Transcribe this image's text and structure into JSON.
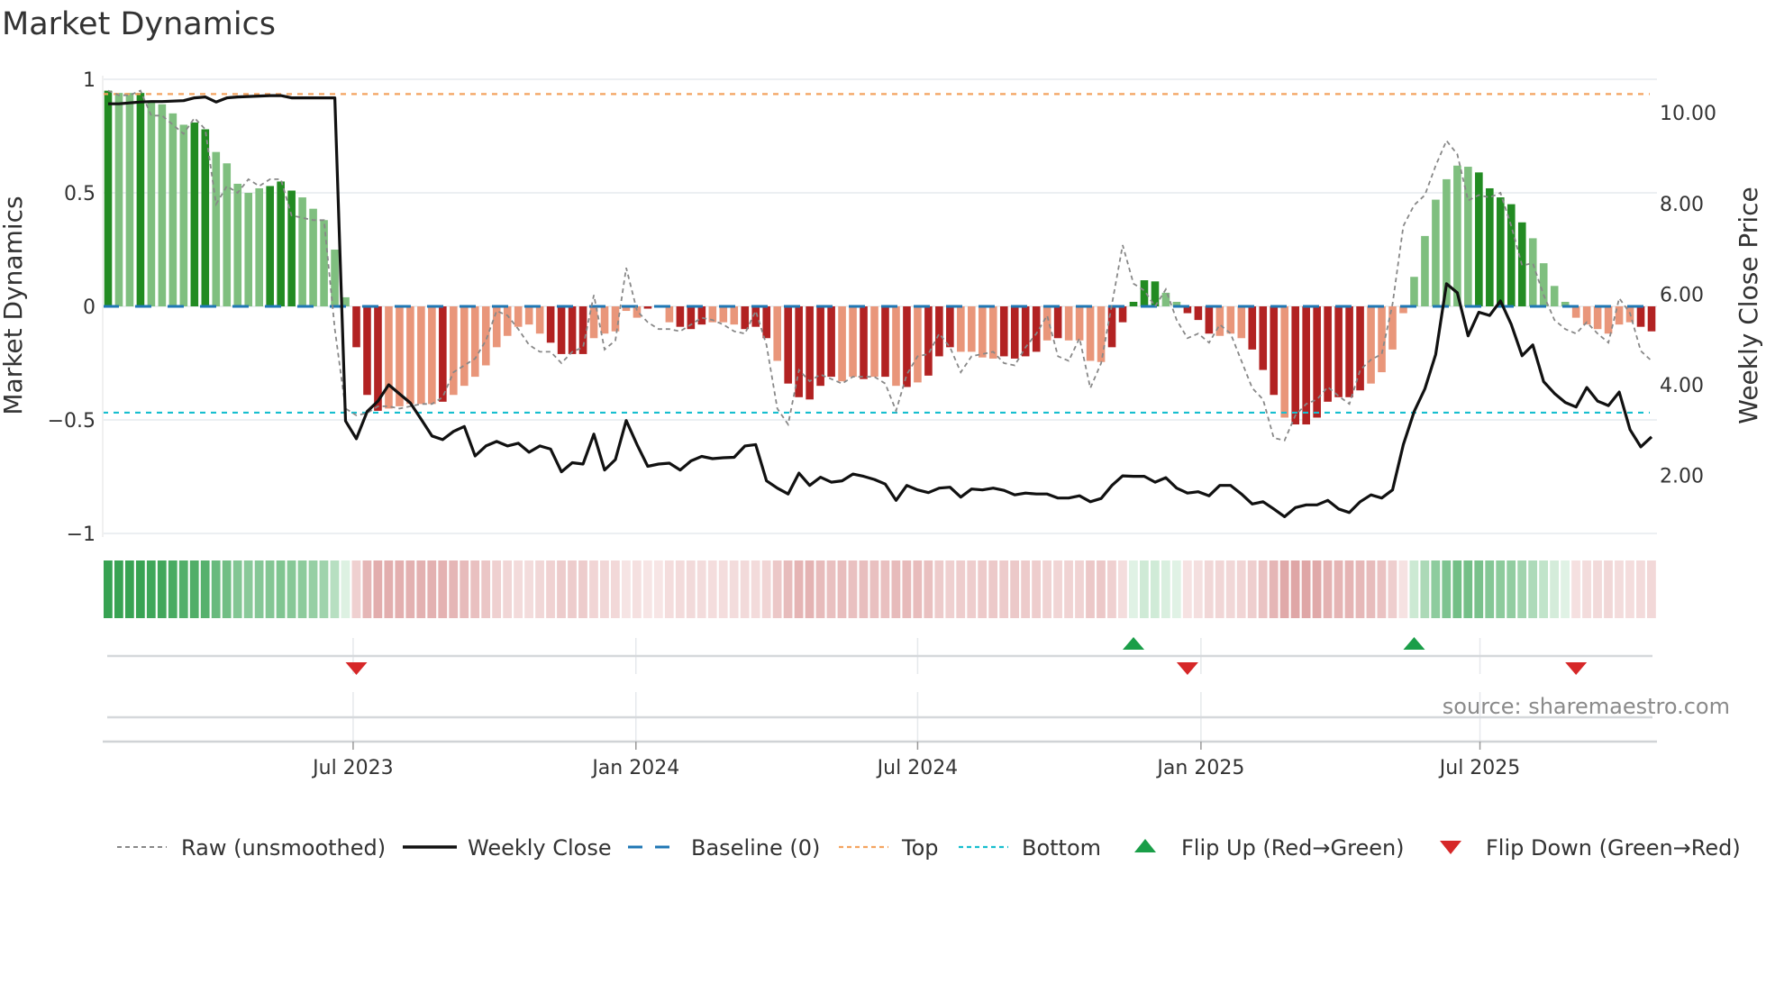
{
  "chart_data": {
    "type": "bar",
    "title": "Market Dynamics",
    "ylabel": "Market Dynamics",
    "y2label": "Weekly Close Price",
    "ylim": [
      -1.016,
      1.016
    ],
    "y2lim": [
      0.64,
      10.82
    ],
    "yticks": [
      {
        "value": 1,
        "label": "1"
      },
      {
        "value": 0.5,
        "label": "0.5"
      },
      {
        "value": 0,
        "label": "0"
      },
      {
        "value": -0.5,
        "label": "−0.5"
      },
      {
        "value": -1,
        "label": "−1"
      }
    ],
    "y2ticks": [
      {
        "value": 10,
        "label": "10.00"
      },
      {
        "value": 8,
        "label": "8.00"
      },
      {
        "value": 6,
        "label": "6.00"
      },
      {
        "value": 4,
        "label": "4.00"
      },
      {
        "value": 2,
        "label": "2.00"
      }
    ],
    "xticks": [
      {
        "week_index": 22.7,
        "label": "Jul 2023"
      },
      {
        "week_index": 48.9,
        "label": "Jan 2024"
      },
      {
        "week_index": 75.0,
        "label": "Jul 2024"
      },
      {
        "week_index": 101.25,
        "label": "Jan 2025"
      },
      {
        "week_index": 127.1,
        "label": "Jul 2025"
      }
    ],
    "grid": true,
    "top_level": 0.935,
    "bottom_level": -0.468,
    "baseline": 0,
    "series": [
      {
        "name": "Market Dynamics (smoothed bars)",
        "values": [
          0.95,
          0.94,
          0.94,
          0.94,
          0.9,
          0.89,
          0.85,
          0.8,
          0.81,
          0.78,
          0.68,
          0.63,
          0.54,
          0.5,
          0.52,
          0.53,
          0.55,
          0.51,
          0.48,
          0.43,
          0.38,
          0.25,
          0.04,
          -0.18,
          -0.39,
          -0.46,
          -0.45,
          -0.44,
          -0.43,
          -0.43,
          -0.43,
          -0.42,
          -0.39,
          -0.35,
          -0.31,
          -0.26,
          -0.18,
          -0.13,
          -0.09,
          -0.08,
          -0.12,
          -0.16,
          -0.21,
          -0.21,
          -0.21,
          -0.14,
          -0.12,
          -0.11,
          -0.02,
          -0.05,
          -0.01,
          -0.005,
          -0.07,
          -0.09,
          -0.1,
          -0.08,
          -0.07,
          -0.07,
          -0.08,
          -0.1,
          -0.09,
          -0.14,
          -0.24,
          -0.34,
          -0.4,
          -0.41,
          -0.35,
          -0.31,
          -0.33,
          -0.31,
          -0.32,
          -0.31,
          -0.31,
          -0.35,
          -0.355,
          -0.335,
          -0.305,
          -0.22,
          -0.18,
          -0.2,
          -0.2,
          -0.225,
          -0.23,
          -0.22,
          -0.23,
          -0.22,
          -0.2,
          -0.15,
          -0.14,
          -0.15,
          -0.15,
          -0.24,
          -0.245,
          -0.18,
          -0.07,
          0.02,
          0.115,
          0.11,
          0.06,
          0.02,
          -0.03,
          -0.06,
          -0.12,
          -0.13,
          -0.12,
          -0.14,
          -0.19,
          -0.28,
          -0.39,
          -0.49,
          -0.52,
          -0.52,
          -0.49,
          -0.42,
          -0.4,
          -0.4,
          -0.37,
          -0.34,
          -0.29,
          -0.19,
          -0.03,
          0.13,
          0.31,
          0.47,
          0.56,
          0.62,
          0.615,
          0.59,
          0.52,
          0.48,
          0.45,
          0.37,
          0.3,
          0.19,
          0.09,
          0.02,
          -0.05,
          -0.08,
          -0.1,
          -0.12,
          -0.08,
          -0.07,
          -0.09,
          -0.11
        ],
        "shade": "dlldllllddllllldddllllldddllllldlllllllllddddllllldlldddllldddldddddlldldldldddllllddddldlllldddddlldddllldddldddddddlllllllllldddddllllllllllddddllddd"
      },
      {
        "name": "Raw (unsmoothed)",
        "values": [
          0.95,
          0.93,
          0.93,
          0.95,
          0.84,
          0.84,
          0.8,
          0.76,
          0.83,
          0.78,
          0.45,
          0.53,
          0.5,
          0.56,
          0.53,
          0.56,
          0.56,
          0.4,
          0.39,
          0.38,
          0.38,
          -0.1,
          -0.45,
          -0.48,
          -0.47,
          -0.44,
          -0.44,
          -0.45,
          -0.44,
          -0.43,
          -0.43,
          -0.4,
          -0.29,
          -0.26,
          -0.23,
          -0.15,
          -0.02,
          -0.04,
          -0.1,
          -0.17,
          -0.2,
          -0.2,
          -0.25,
          -0.2,
          -0.18,
          0.05,
          -0.19,
          -0.15,
          0.17,
          -0.02,
          -0.07,
          -0.1,
          -0.1,
          -0.11,
          -0.08,
          -0.05,
          -0.06,
          -0.08,
          -0.11,
          -0.12,
          -0.02,
          -0.17,
          -0.45,
          -0.52,
          -0.28,
          -0.33,
          -0.3,
          -0.32,
          -0.34,
          -0.31,
          -0.31,
          -0.31,
          -0.34,
          -0.46,
          -0.3,
          -0.22,
          -0.21,
          -0.12,
          -0.18,
          -0.29,
          -0.22,
          -0.21,
          -0.2,
          -0.25,
          -0.26,
          -0.18,
          -0.12,
          -0.04,
          -0.22,
          -0.24,
          -0.14,
          -0.36,
          -0.25,
          0.01,
          0.27,
          0.1,
          0.07,
          0.0,
          0.075,
          -0.06,
          -0.14,
          -0.12,
          -0.16,
          -0.08,
          -0.12,
          -0.24,
          -0.36,
          -0.41,
          -0.58,
          -0.59,
          -0.48,
          -0.43,
          -0.41,
          -0.355,
          -0.395,
          -0.43,
          -0.28,
          -0.235,
          -0.21,
          0.01,
          0.354,
          0.446,
          0.49,
          0.62,
          0.73,
          0.67,
          0.466,
          0.49,
          0.48,
          0.5,
          0.354,
          0.18,
          0.19,
          0.05,
          -0.06,
          -0.1,
          -0.12,
          -0.07,
          -0.12,
          -0.16,
          0.036,
          -0.03,
          -0.196,
          -0.24
        ]
      },
      {
        "name": "Weekly Close",
        "axis": "right",
        "values": [
          10.2,
          10.2,
          10.22,
          10.24,
          10.25,
          10.25,
          10.26,
          10.27,
          10.33,
          10.35,
          10.24,
          10.33,
          10.35,
          10.36,
          10.37,
          10.38,
          10.38,
          10.33,
          10.33,
          10.33,
          10.33,
          10.33,
          3.2,
          2.81,
          3.41,
          3.64,
          4.0,
          3.8,
          3.6,
          3.24,
          2.87,
          2.79,
          2.97,
          3.08,
          2.43,
          2.65,
          2.75,
          2.65,
          2.71,
          2.51,
          2.65,
          2.58,
          2.08,
          2.28,
          2.25,
          2.91,
          2.12,
          2.35,
          3.21,
          2.68,
          2.2,
          2.25,
          2.27,
          2.12,
          2.32,
          2.42,
          2.37,
          2.39,
          2.4,
          2.65,
          2.68,
          1.88,
          1.72,
          1.59,
          2.05,
          1.78,
          1.96,
          1.85,
          1.88,
          2.03,
          1.98,
          1.91,
          1.81,
          1.45,
          1.78,
          1.68,
          1.62,
          1.72,
          1.74,
          1.52,
          1.7,
          1.68,
          1.72,
          1.67,
          1.57,
          1.61,
          1.59,
          1.59,
          1.5,
          1.5,
          1.55,
          1.42,
          1.49,
          1.78,
          1.99,
          1.98,
          1.98,
          1.85,
          1.95,
          1.72,
          1.61,
          1.64,
          1.55,
          1.78,
          1.78,
          1.59,
          1.37,
          1.42,
          1.26,
          1.09,
          1.29,
          1.35,
          1.35,
          1.45,
          1.26,
          1.18,
          1.42,
          1.57,
          1.5,
          1.68,
          2.68,
          3.41,
          3.91,
          4.67,
          6.23,
          6.03,
          5.08,
          5.6,
          5.53,
          5.85,
          5.33,
          4.64,
          4.88,
          4.07,
          3.81,
          3.61,
          3.51,
          3.94,
          3.64,
          3.54,
          3.84,
          3.01,
          2.63,
          2.85
        ]
      }
    ],
    "flips": [
      {
        "week_index": 23,
        "type": "down"
      },
      {
        "week_index": 95,
        "type": "up"
      },
      {
        "week_index": 100,
        "type": "down"
      },
      {
        "week_index": 121,
        "type": "up"
      },
      {
        "week_index": 136,
        "type": "down"
      }
    ],
    "legend": {
      "placement": "bottom",
      "items": [
        {
          "key": "raw",
          "label": "Raw (unsmoothed)"
        },
        {
          "key": "close",
          "label": "Weekly Close"
        },
        {
          "key": "baseline",
          "label": "Baseline (0)"
        },
        {
          "key": "top",
          "label": "Top"
        },
        {
          "key": "bottom",
          "label": "Bottom"
        },
        {
          "key": "flipup",
          "label": "Flip Up (Red→Green)"
        },
        {
          "key": "flipdown",
          "label": "Flip Down (Green→Red)"
        }
      ]
    },
    "source": "source: sharemaestro.com"
  },
  "colors": {
    "green_dark": "#228b22",
    "green_light": "#7fbf7f",
    "red_dark": "#b22222",
    "red_light": "#e9967a",
    "raw": "#888888",
    "close": "#111111",
    "baseline": "#1f77b4",
    "top": "#f4a460",
    "bottom": "#17becf",
    "flip_up": "#1a9e48",
    "flip_down": "#d62728"
  }
}
